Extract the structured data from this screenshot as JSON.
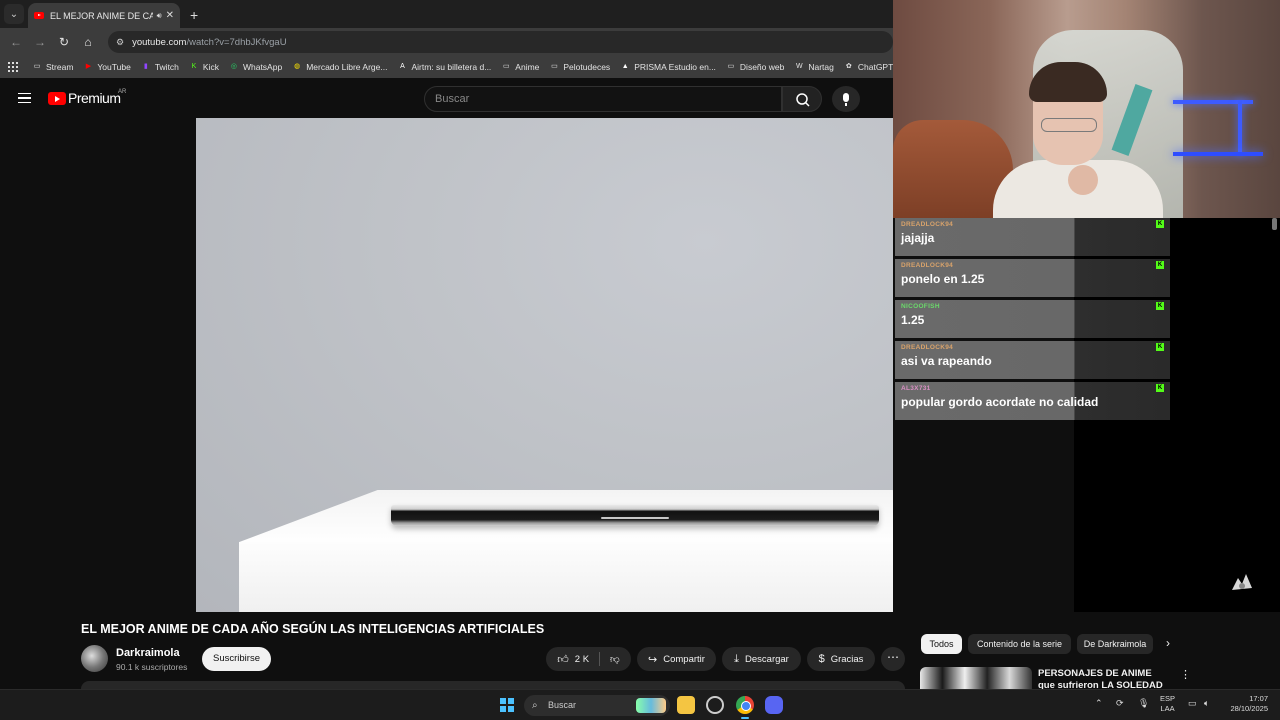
{
  "browser": {
    "tab_title": "EL MEJOR ANIME DE CADA",
    "url_host": "youtube.com",
    "url_path": "/watch?v=7dhbJKfvgaU",
    "bookmarks": [
      {
        "label": "Stream",
        "icon": "folder-icon",
        "color": "#e3e3e3"
      },
      {
        "label": "YouTube",
        "icon": "youtube-icon",
        "color": "#ff0000"
      },
      {
        "label": "Twitch",
        "icon": "twitch-icon",
        "color": "#9146ff"
      },
      {
        "label": "Kick",
        "icon": "kick-icon",
        "color": "#53fc18"
      },
      {
        "label": "WhatsApp",
        "icon": "whatsapp-icon",
        "color": "#25d366"
      },
      {
        "label": "Mercado Libre Arge...",
        "icon": "mercadolibre-icon",
        "color": "#ffe600"
      },
      {
        "label": "Airtm: su billetera d...",
        "icon": "airtm-icon",
        "color": "#ffffff"
      },
      {
        "label": "Anime",
        "icon": "folder-icon",
        "color": "#e3e3e3"
      },
      {
        "label": "Pelotudeces",
        "icon": "folder-icon",
        "color": "#e3e3e3"
      },
      {
        "label": "PRISMA Estudio en...",
        "icon": "prisma-icon",
        "color": "#ffffff"
      },
      {
        "label": "Diseño web",
        "icon": "folder-icon",
        "color": "#e3e3e3"
      },
      {
        "label": "Nartag",
        "icon": "wordpress-icon",
        "color": "#e3e3e3"
      },
      {
        "label": "ChatGPT",
        "icon": "chatgpt-icon",
        "color": "#e3e3e3"
      }
    ]
  },
  "youtube": {
    "brand": "Premium",
    "region": "AR",
    "search_placeholder": "Buscar"
  },
  "chat": {
    "messages": [
      {
        "user": "DREADLOCK94",
        "text": "jajajja",
        "user_color": "#d9a36b"
      },
      {
        "user": "DREADLOCK94",
        "text": "ponelo en 1.25",
        "user_color": "#d9a36b"
      },
      {
        "user": "NICOOFISH",
        "text": "1.25",
        "user_color": "#6bd96b"
      },
      {
        "user": "DREADLOCK94",
        "text": "asi va rapeando",
        "user_color": "#d9a36b"
      },
      {
        "user": "AL3X731",
        "text": "popular gordo acordate no calidad",
        "user_color": "#d98fc4"
      }
    ]
  },
  "video": {
    "title": "EL MEJOR ANIME DE CADA AÑO SEGÚN LAS INTELIGENCIAS ARTIFICIALES",
    "channel": "Darkraimola",
    "subscribers": "90.1 k suscriptores",
    "subscribe_label": "Suscribirse",
    "likes": "2 K",
    "share_label": "Compartir",
    "download_label": "Descargar",
    "thanks_label": "Gracias"
  },
  "sidebar": {
    "chips": [
      "Todos",
      "Contenido de la serie",
      "De Darkraimola"
    ],
    "recommendation_title": "PERSONAJES DE ANIME que sufrieron LA SOLEDAD DEL"
  },
  "taskbar": {
    "search_label": "Buscar",
    "lang_top": "ESP",
    "lang_bottom": "LAA",
    "time": "17:07",
    "date": "28/10/2025"
  }
}
